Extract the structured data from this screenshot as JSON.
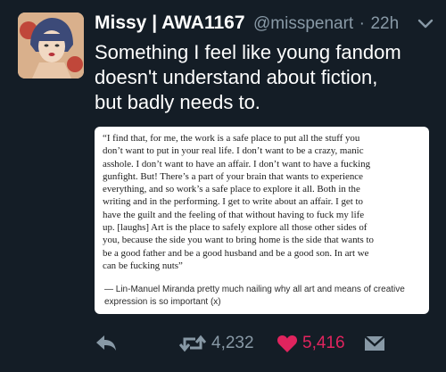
{
  "tweet": {
    "display_name": "Missy | AWA1167",
    "handle": "@misspenart",
    "separator": "·",
    "time": "22h",
    "text": "Something I feel like young fandom\ndoesn't understand about fiction,\nbut badly needs to."
  },
  "quote": {
    "text": "“I find that, for me, the work is a safe place to put all the stuff you\ndon’t want to put in your real life. I don’t want to be a crazy, manic\nasshole. I don’t want to have an affair. I don’t want to have a fucking\ngunfight. But! There’s a part of your brain that wants to experience\neverything, and so work’s a safe place to explore it all. Both in the\nwriting and in the performing. I get to write about an affair. I get to\nhave the guilt and the feeling of that without having to fuck my life\nup. [laughs] Art is the place to safely explore all those other sides of\nyou, because the side you want to bring home is the side that wants to\nbe a good father and be a good husband and be a good son. In art we\ncan be fucking nuts”",
    "attribution": "— Lin-Manuel Miranda pretty much nailing why all art and means of creative\n   expression is so important (x)"
  },
  "actions": {
    "retweet_count": "4,232",
    "like_count": "5,416"
  },
  "colors": {
    "background": "#141d26",
    "secondary_text": "#8899a6",
    "like": "#e0245e"
  },
  "icons": [
    "avatar-image",
    "chevron-down-icon",
    "reply-icon",
    "retweet-icon",
    "heart-icon",
    "direct-message-icon"
  ]
}
